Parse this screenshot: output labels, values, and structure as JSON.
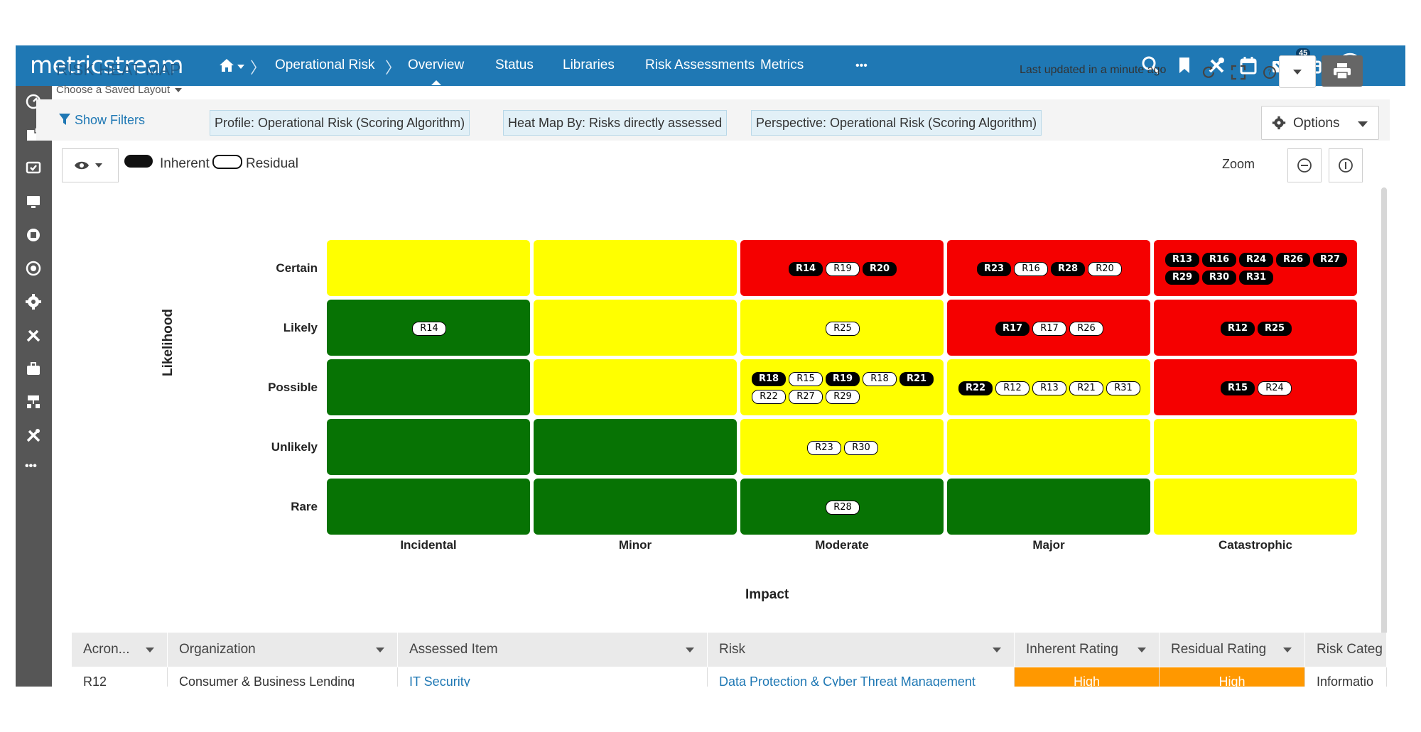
{
  "colors": {
    "brand": "#1f78b4",
    "sidebar": "#565656",
    "green": "#077304",
    "yellow": "#ffff00",
    "red": "#f50000",
    "high": "#ff9800"
  },
  "topbar": {
    "logo": "metricstream",
    "breadcrumb": "Operational Risk",
    "tabs": [
      "Overview",
      "Status",
      "Libraries",
      "Risk Assessments",
      "Metrics"
    ],
    "more": "•••",
    "notification_count": "45"
  },
  "header": {
    "title": "RISK HEAT MAP",
    "layout_link": "Choose a Saved Layout",
    "last_updated": "Last updated in a minute ago"
  },
  "filters": {
    "show_filters": "Show Filters",
    "chips": [
      "Profile: Operational Risk (Scoring Algorithm)",
      "Heat Map By: Risks directly assessed",
      "Perspective: Operational Risk (Scoring Algorithm)"
    ],
    "options": "Options"
  },
  "legend": {
    "inherent": "Inherent",
    "residual": "Residual",
    "zoom": "Zoom"
  },
  "heatmap": {
    "y_title": "Likelihood",
    "x_title": "Impact",
    "rows": [
      "Certain",
      "Likely",
      "Possible",
      "Unlikely",
      "Rare"
    ],
    "cols": [
      "Incidental",
      "Minor",
      "Moderate",
      "Major",
      "Catastrophic"
    ],
    "colors": [
      [
        "yellow",
        "yellow",
        "red",
        "red",
        "red"
      ],
      [
        "green",
        "yellow",
        "yellow",
        "red",
        "red"
      ],
      [
        "green",
        "yellow",
        "yellow",
        "yellow",
        "red"
      ],
      [
        "green",
        "green",
        "yellow",
        "yellow",
        "yellow"
      ],
      [
        "green",
        "green",
        "green",
        "green",
        "yellow"
      ]
    ],
    "cells": [
      [
        [],
        [],
        [
          [
            "R14",
            "i"
          ],
          [
            "R19",
            "r"
          ],
          [
            "R20",
            "i"
          ]
        ],
        [
          [
            "R23",
            "i"
          ],
          [
            "R16",
            "r"
          ],
          [
            "R28",
            "i"
          ],
          [
            "R20",
            "r"
          ]
        ],
        [
          [
            "R13",
            "i"
          ],
          [
            "R16",
            "i"
          ],
          [
            "R24",
            "i"
          ],
          [
            "R26",
            "i"
          ],
          [
            "R27",
            "i"
          ],
          [
            "R29",
            "i"
          ],
          [
            "R30",
            "i"
          ],
          [
            "R31",
            "i"
          ]
        ]
      ],
      [
        [
          [
            "R14",
            "r"
          ]
        ],
        [],
        [
          [
            "R25",
            "r"
          ]
        ],
        [
          [
            "R17",
            "i"
          ],
          [
            "R17",
            "r"
          ],
          [
            "R26",
            "r"
          ]
        ],
        [
          [
            "R12",
            "i"
          ],
          [
            "R25",
            "i"
          ]
        ]
      ],
      [
        [],
        [],
        [
          [
            "R18",
            "i"
          ],
          [
            "R15",
            "r"
          ],
          [
            "R19",
            "i"
          ],
          [
            "R18",
            "r"
          ],
          [
            "R21",
            "i"
          ],
          [
            "R22",
            "r"
          ],
          [
            "R27",
            "r"
          ],
          [
            "R29",
            "r"
          ]
        ],
        [
          [
            "R22",
            "i"
          ],
          [
            "R12",
            "r"
          ],
          [
            "R13",
            "r"
          ],
          [
            "R21",
            "r"
          ],
          [
            "R31",
            "r"
          ]
        ],
        [
          [
            "R15",
            "i"
          ],
          [
            "R24",
            "r"
          ]
        ]
      ],
      [
        [],
        [],
        [
          [
            "R23",
            "r"
          ],
          [
            "R30",
            "r"
          ]
        ],
        [],
        []
      ],
      [
        [],
        [],
        [
          [
            "R28",
            "r"
          ]
        ],
        [],
        []
      ]
    ]
  },
  "table": {
    "columns": [
      "Acron...",
      "Organization",
      "Assessed Item",
      "Risk",
      "Inherent Rating",
      "Residual Rating",
      "Risk Categ"
    ],
    "rows": [
      [
        "R12",
        "Consumer & Business Lending",
        "IT Security",
        "Data Protection & Cyber Threat Management",
        "High",
        "High",
        "Informatio"
      ]
    ]
  }
}
